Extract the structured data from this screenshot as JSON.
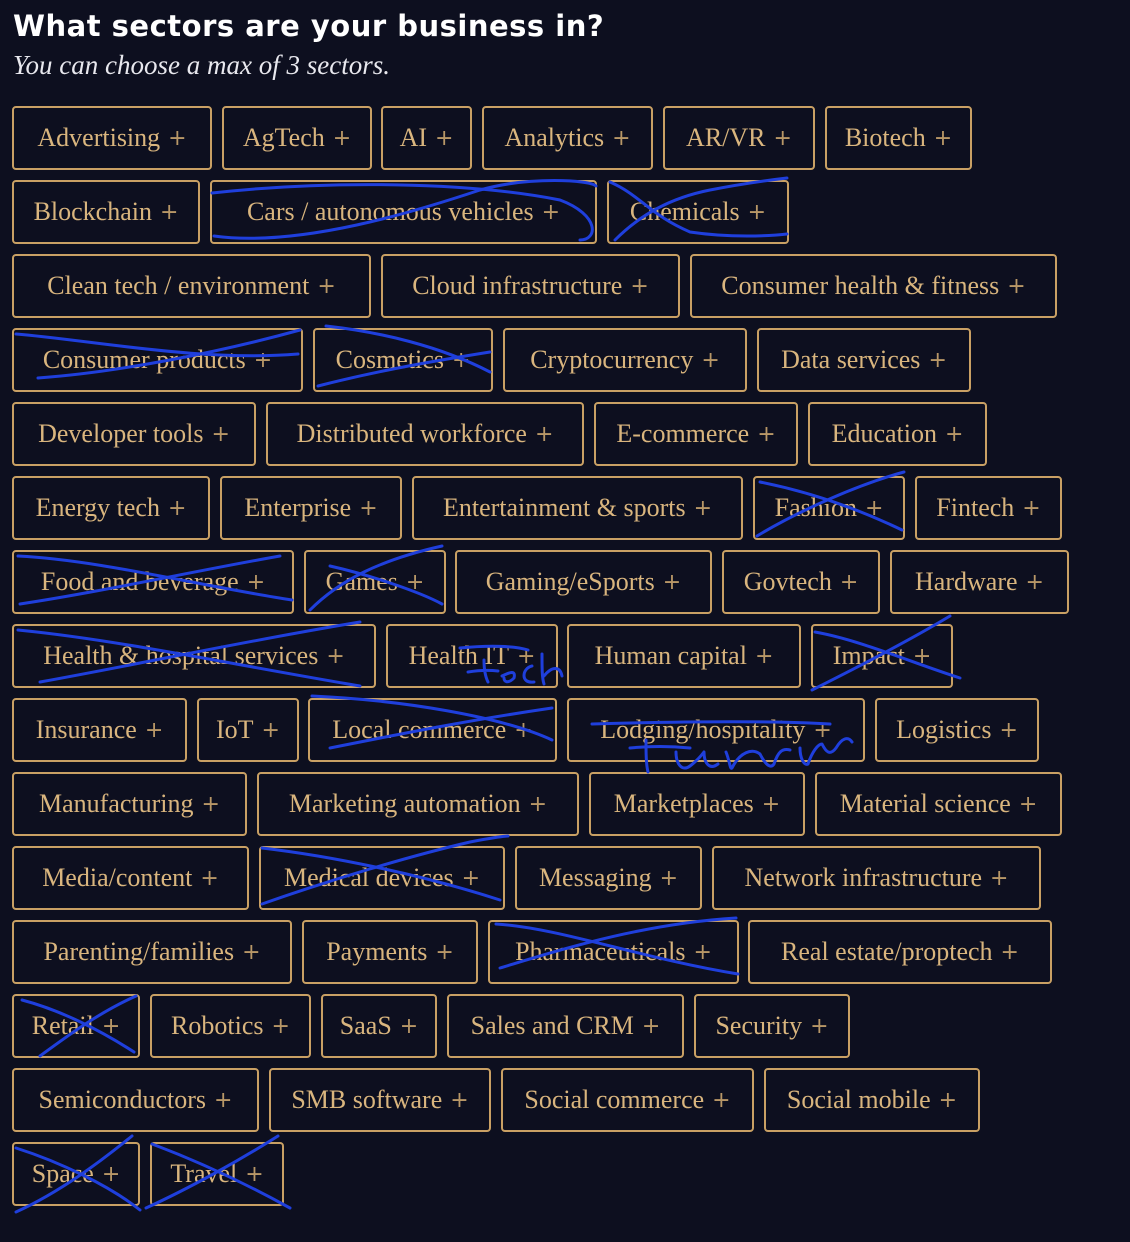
{
  "header": {
    "title": "What sectors are your business in?",
    "subtitle": "You can choose a max of 3 sectors."
  },
  "plus_glyph": "+",
  "colors": {
    "background": "#0d0f1f",
    "chip_border": "#c9a064",
    "chip_text": "#d9b57e",
    "pen_annotation": "#1f3fdc"
  },
  "sectors": [
    {
      "label": "Advertising",
      "crossed": false
    },
    {
      "label": "AgTech",
      "crossed": false
    },
    {
      "label": "AI",
      "crossed": false
    },
    {
      "label": "Analytics",
      "crossed": false
    },
    {
      "label": "AR/VR",
      "crossed": false
    },
    {
      "label": "Biotech",
      "crossed": false
    },
    {
      "label": "Blockchain",
      "crossed": false
    },
    {
      "label": "Cars / autonomous vehicles",
      "crossed": true
    },
    {
      "label": "Chemicals",
      "crossed": true
    },
    {
      "label": "Clean tech / environment",
      "crossed": false
    },
    {
      "label": "Cloud infrastructure",
      "crossed": false
    },
    {
      "label": "Consumer health & fitness",
      "crossed": false
    },
    {
      "label": "Consumer products",
      "crossed": true
    },
    {
      "label": "Cosmetics",
      "crossed": true
    },
    {
      "label": "Cryptocurrency",
      "crossed": false
    },
    {
      "label": "Data services",
      "crossed": false
    },
    {
      "label": "Developer tools",
      "crossed": false
    },
    {
      "label": "Distributed workforce",
      "crossed": false
    },
    {
      "label": "E-commerce",
      "crossed": false
    },
    {
      "label": "Education",
      "crossed": false
    },
    {
      "label": "Energy tech",
      "crossed": false
    },
    {
      "label": "Enterprise",
      "crossed": false
    },
    {
      "label": "Entertainment & sports",
      "crossed": false
    },
    {
      "label": "Fashion",
      "crossed": true
    },
    {
      "label": "Fintech",
      "crossed": false
    },
    {
      "label": "Food and beverage",
      "crossed": true
    },
    {
      "label": "Games",
      "crossed": true
    },
    {
      "label": "Gaming/eSports",
      "crossed": false
    },
    {
      "label": "Govtech",
      "crossed": false
    },
    {
      "label": "Hardware",
      "crossed": false
    },
    {
      "label": "Health & hospital services",
      "crossed": true
    },
    {
      "label": "Health IT",
      "crossed": true
    },
    {
      "label": "Human capital",
      "crossed": false
    },
    {
      "label": "Impact",
      "crossed": true
    },
    {
      "label": "Insurance",
      "crossed": false
    },
    {
      "label": "IoT",
      "crossed": false
    },
    {
      "label": "Local commerce",
      "crossed": true
    },
    {
      "label": "Lodging/hospitality",
      "crossed": true
    },
    {
      "label": "Logistics",
      "crossed": false
    },
    {
      "label": "Manufacturing",
      "crossed": false
    },
    {
      "label": "Marketing automation",
      "crossed": false
    },
    {
      "label": "Marketplaces",
      "crossed": false
    },
    {
      "label": "Material science",
      "crossed": false
    },
    {
      "label": "Media/content",
      "crossed": false
    },
    {
      "label": "Medical devices",
      "crossed": true
    },
    {
      "label": "Messaging",
      "crossed": false
    },
    {
      "label": "Network infrastructure",
      "crossed": false
    },
    {
      "label": "Parenting/families",
      "crossed": false
    },
    {
      "label": "Payments",
      "crossed": false
    },
    {
      "label": "Pharmaceuticals",
      "crossed": true
    },
    {
      "label": "Real estate/proptech",
      "crossed": false
    },
    {
      "label": "Retail",
      "crossed": true
    },
    {
      "label": "Robotics",
      "crossed": false
    },
    {
      "label": "SaaS",
      "crossed": false
    },
    {
      "label": "Sales and CRM",
      "crossed": false
    },
    {
      "label": "Security",
      "crossed": false
    },
    {
      "label": "Semiconductors",
      "crossed": false
    },
    {
      "label": "SMB software",
      "crossed": false
    },
    {
      "label": "Social commerce",
      "crossed": false
    },
    {
      "label": "Social mobile",
      "crossed": false
    },
    {
      "label": "Space",
      "crossed": true
    },
    {
      "label": "Travel",
      "crossed": true
    }
  ]
}
